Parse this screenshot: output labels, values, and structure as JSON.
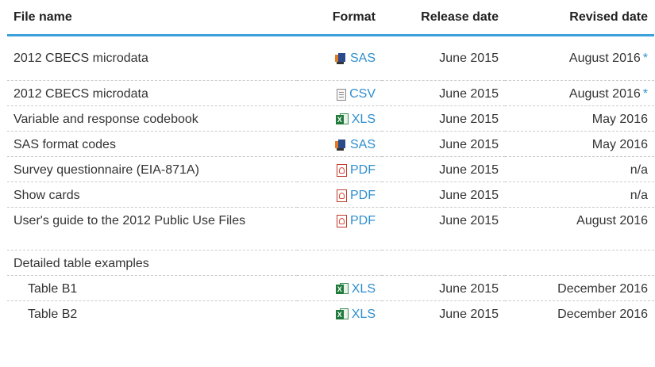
{
  "headers": {
    "name": "File name",
    "format": "Format",
    "release": "Release date",
    "revised": "Revised date"
  },
  "rows": [
    {
      "name": "2012 CBECS microdata",
      "format": "SAS",
      "icon": "sas-icon",
      "release": "June 2015",
      "revised": "August 2016",
      "asterisk": "*"
    },
    {
      "name": "2012 CBECS microdata",
      "format": "CSV",
      "icon": "csv-icon",
      "release": "June 2015",
      "revised": "August 2016",
      "asterisk": "*"
    },
    {
      "name": "Variable and response codebook",
      "format": "XLS",
      "icon": "xls-icon",
      "release": "June 2015",
      "revised": "May 2016"
    },
    {
      "name": "SAS format codes",
      "format": "SAS",
      "icon": "sas-icon",
      "release": "June 2015",
      "revised": "May 2016"
    },
    {
      "name": "Survey questionnaire (EIA-871A)",
      "format": "PDF",
      "icon": "pdf-icon",
      "release": "June 2015",
      "revised": "n/a"
    },
    {
      "name": "Show cards",
      "format": "PDF",
      "icon": "pdf-icon",
      "release": "June 2015",
      "revised": "n/a"
    },
    {
      "name": "User's guide to the 2012 Public Use Files",
      "format": "PDF",
      "icon": "pdf-icon",
      "release": "June 2015",
      "revised": "August 2016"
    },
    {
      "name": "Detailed table examples"
    },
    {
      "name": "Table B1",
      "format": "XLS",
      "icon": "xls-icon",
      "release": "June 2015",
      "revised": "December 2016"
    },
    {
      "name": "Table B2",
      "format": "XLS",
      "icon": "xls-icon",
      "release": "June 2015",
      "revised": "December 2016"
    }
  ],
  "colors": {
    "accent": "#3aa1dc",
    "link": "#2f8fce"
  }
}
